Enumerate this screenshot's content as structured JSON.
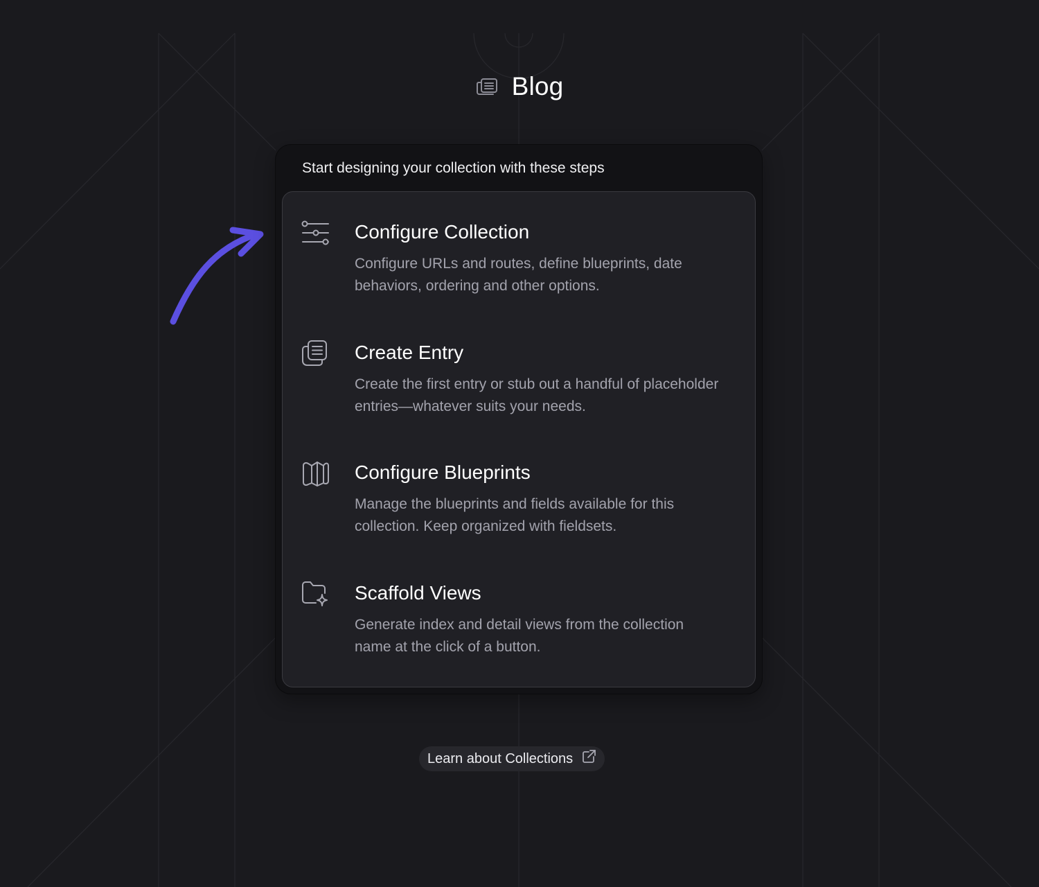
{
  "header": {
    "title": "Blog",
    "icon": "collection-icon"
  },
  "card": {
    "subtitle": "Start designing your collection with these steps",
    "steps": [
      {
        "title": "Configure Collection",
        "description": "Configure URLs and routes, define blueprints, date behaviors, ordering and other options.",
        "icon": "sliders-icon"
      },
      {
        "title": "Create Entry",
        "description": "Create the first entry or stub out a handful of placeholder entries—whatever suits your needs.",
        "icon": "entries-icon"
      },
      {
        "title": "Configure Blueprints",
        "description": "Manage the blueprints and fields available for this collection. Keep organized with fieldsets.",
        "icon": "map-icon"
      },
      {
        "title": "Scaffold Views",
        "description": "Generate index and detail views from the collection name at the click of a button.",
        "icon": "folder-sparkle-icon"
      }
    ]
  },
  "learn": {
    "label": "Learn about Collections",
    "icon": "external-link-icon"
  },
  "colors": {
    "background": "#1a1a1e",
    "card_outer": "#121215",
    "card_inner": "#202025",
    "accent_arrow": "#5b4fe0",
    "muted_text": "#a3a3ad"
  }
}
